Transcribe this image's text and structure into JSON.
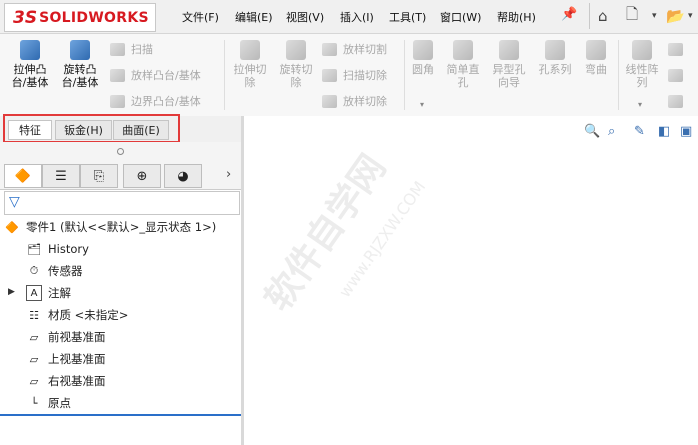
{
  "app": {
    "logo_ds": "3S",
    "logo_name": "SOLIDWORKS"
  },
  "menu": [
    "文件(F)",
    "编辑(E)",
    "视图(V)",
    "插入(I)",
    "工具(T)",
    "窗口(W)",
    "帮助(H)"
  ],
  "ribbon": {
    "extrude_boss": "拉伸凸\n台/基体",
    "revolve_boss": "旋转凸\n台/基体",
    "sweep": "扫描",
    "loft_boss": "放样凸台/基体",
    "boundary_boss": "边界凸台/基体",
    "extrude_cut": "拉伸切\n除",
    "revolve_cut": "旋转切\n除",
    "loft_cut": "放样切割",
    "sweep_cut": "扫描切除",
    "loft_cut2": "放样切除",
    "fillet": "圆角",
    "simple_hole": "简单直\n孔",
    "hole_wizard": "异型孔\n向导",
    "hole_series": "孔系列",
    "bend": "弯曲",
    "linear_pattern": "线性阵\n列"
  },
  "tabs": [
    "特征",
    "钣金(H)",
    "曲面(E)"
  ],
  "tree": {
    "root": "零件1 (默认<<默认>_显示状态 1>)",
    "items": [
      "History",
      "传感器",
      "注解",
      "材质 <未指定>",
      "前视基准面",
      "上视基准面",
      "右视基准面",
      "原点"
    ]
  },
  "watermark": {
    "main": "软件自学网",
    "url": "www.RJZXW.COM"
  },
  "colors": {
    "brand_red": "#d71920",
    "highlight_box": "#e23a3a",
    "accent_blue": "#2a6fc9"
  }
}
